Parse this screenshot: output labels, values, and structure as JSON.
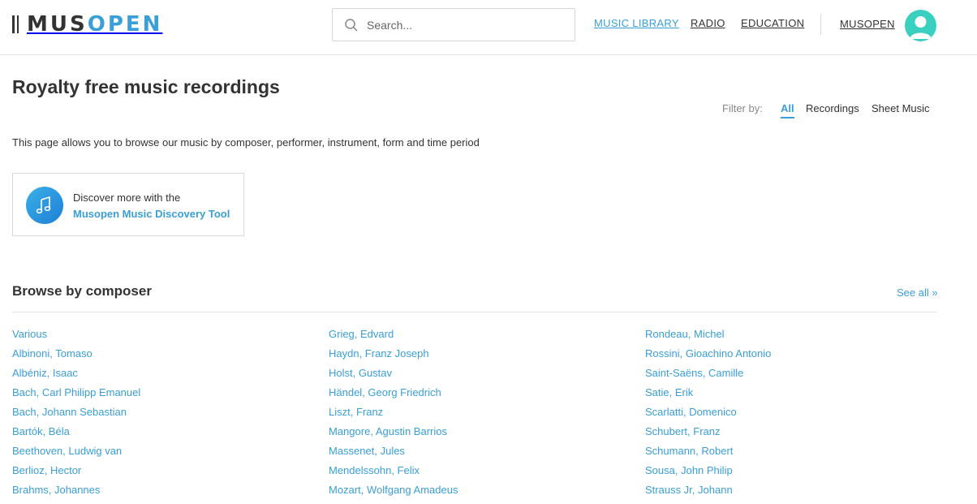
{
  "header": {
    "logo": {
      "mus": "MUS",
      "open": "OPEN"
    },
    "search": {
      "placeholder": "Search..."
    },
    "nav": {
      "music_library": "MUSIC LIBRARY",
      "radio": "RADIO",
      "education": "EDUCATION",
      "user": "MUSOPEN"
    },
    "accent_color": "#3a9fd8",
    "avatar_color": "#39d0c0"
  },
  "page": {
    "title": "Royalty free music recordings",
    "filter": {
      "label": "Filter by:",
      "all": "All",
      "recordings": "Recordings",
      "sheet_music": "Sheet Music"
    },
    "description": "This page allows you to browse our music by composer, performer, instrument, form and time period",
    "discover": {
      "line1": "Discover more with the",
      "link": "Musopen Music Discovery Tool",
      "icon": "music-note-icon"
    }
  },
  "browse": {
    "heading": "Browse by composer",
    "see_all": "See all »",
    "columns": [
      [
        "Various",
        "Albinoni, Tomaso",
        "Albéniz, Isaac",
        "Bach, Carl Philipp Emanuel",
        "Bach, Johann Sebastian",
        "Bartók, Béla",
        "Beethoven, Ludwig van",
        "Berlioz, Hector",
        "Brahms, Johannes"
      ],
      [
        "Grieg, Edvard",
        "Haydn, Franz Joseph",
        "Holst, Gustav",
        "Händel, Georg Friedrich",
        "Liszt, Franz",
        "Mangore, Agustin Barrios",
        "Massenet, Jules",
        "Mendelssohn, Felix",
        "Mozart, Wolfgang Amadeus"
      ],
      [
        "Rondeau, Michel",
        "Rossini, Gioachino Antonio",
        "Saint-Saëns, Camille",
        "Satie, Erik",
        "Scarlatti, Domenico",
        "Schubert, Franz",
        "Schumann, Robert",
        "Sousa, John Philip",
        "Strauss Jr, Johann"
      ]
    ]
  }
}
